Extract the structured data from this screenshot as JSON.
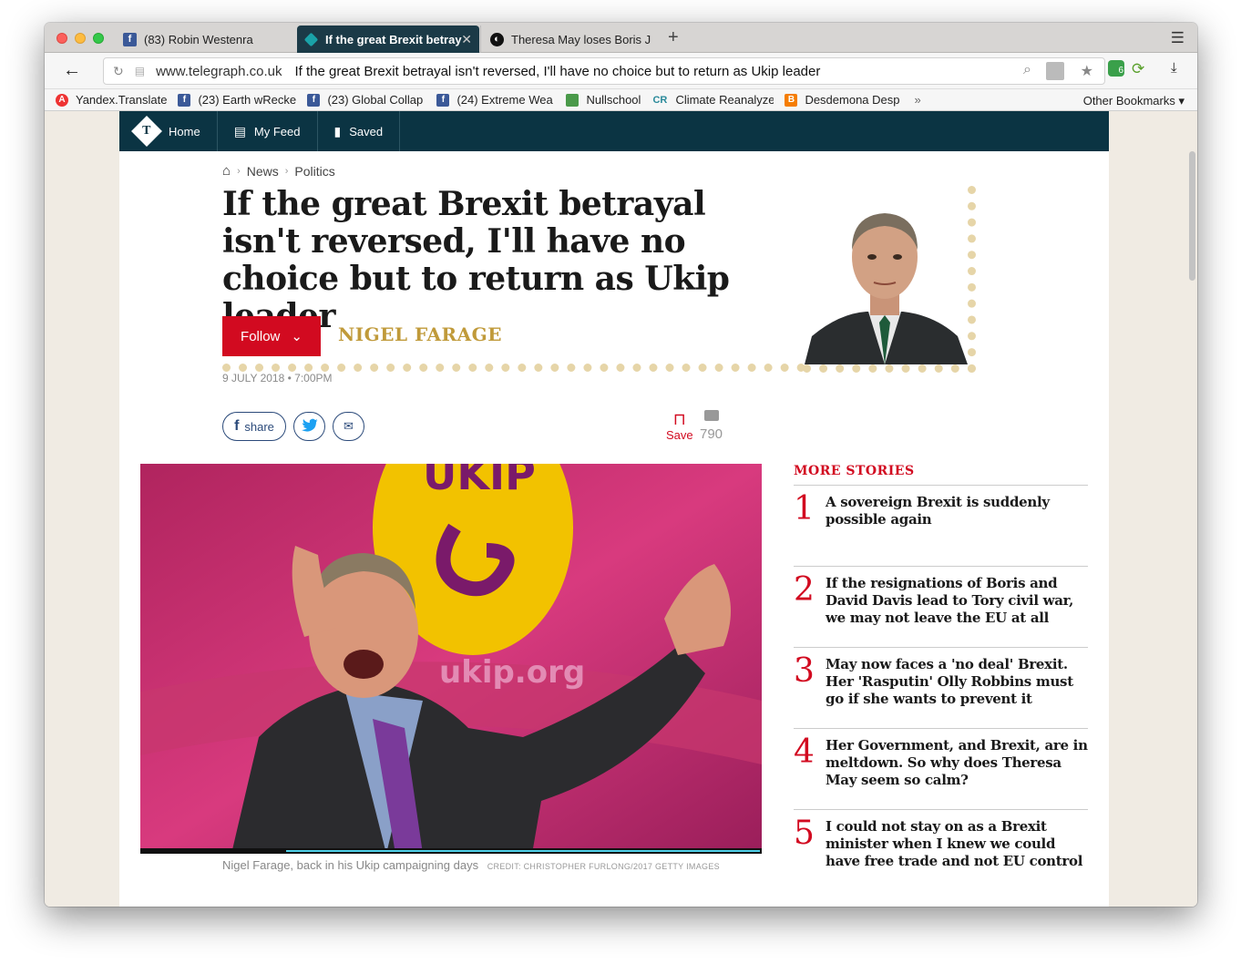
{
  "browser": {
    "tabs": [
      {
        "label": "(83) Robin Westenra",
        "favicon": "facebook-icon"
      },
      {
        "label": "If the great Brexit betray",
        "favicon": "telegraph-icon",
        "active": true
      },
      {
        "label": "Theresa May loses Boris J",
        "favicon": "globe-icon"
      }
    ],
    "url_domain": "www.telegraph.co.uk",
    "url_title": "If the great Brexit betrayal isn't reversed, I'll have no choice but to return as Ukip leader",
    "bookmarks": [
      "Yandex.Translate",
      "(23) Earth wRecke",
      "(23) Global Collap",
      "(24) Extreme Wea",
      "Nullschool",
      "Climate Reanalyze",
      "Desdemona Desp"
    ],
    "other_bookmarks": "Other Bookmarks",
    "ext_badge": "6"
  },
  "topnav": {
    "home": "Home",
    "feed": "My Feed",
    "saved": "Saved"
  },
  "breadcrumb": {
    "level1": "News",
    "level2": "Politics"
  },
  "article": {
    "headline": "If the great Brexit betrayal isn't reversed, I'll have no choice but to return as Ukip leader",
    "follow_label": "Follow",
    "author": "NIGEL FARAGE",
    "date": "9 JULY 2018 • 7:00PM",
    "share_label": "share",
    "save_label": "Save",
    "comment_count": "790",
    "caption": "Nigel Farage, back in his Ukip campaigning days",
    "credit": "CREDIT: CHRISTOPHER FURLONG/2017 GETTY IMAGES",
    "image_text_1": "UKIP",
    "image_text_2": "ukip.org"
  },
  "more_stories": {
    "heading": "MORE STORIES",
    "items": [
      {
        "num": "1",
        "title": "A sovereign Brexit is suddenly possible again"
      },
      {
        "num": "2",
        "title": "If the resignations of Boris and David Davis lead to Tory civil war, we may not leave the EU at all"
      },
      {
        "num": "3",
        "title": "May now faces a 'no deal' Brexit. Her 'Rasputin' Olly Robbins must go if she wants to prevent it"
      },
      {
        "num": "4",
        "title": "Her Government, and Brexit, are in meltdown. So why does Theresa May seem so calm?"
      },
      {
        "num": "5",
        "title": "I could not stay on as a Brexit minister when I knew we could have free trade and not EU control"
      }
    ]
  },
  "colors": {
    "brand_navy": "#0b3443",
    "accent_red": "#d20a20",
    "author_gold": "#c09a3a"
  }
}
